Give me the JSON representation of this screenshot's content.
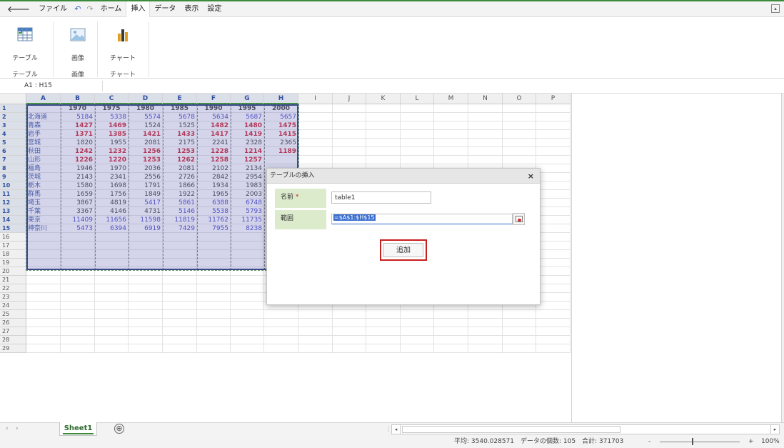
{
  "menu": {
    "file": "ファイル",
    "tabs": [
      "ホーム",
      "挿入",
      "データ",
      "表示",
      "設定"
    ],
    "active_tab": "挿入"
  },
  "ribbon": {
    "table_label": "テーブル",
    "image_label": "画像",
    "chart_label": "チャート",
    "group_table": "テーブル",
    "group_image": "画像",
    "group_chart": "チャート"
  },
  "namebox": "A1 : H15",
  "columns": [
    "A",
    "B",
    "C",
    "D",
    "E",
    "F",
    "G",
    "H",
    "I",
    "J",
    "K",
    "L",
    "M",
    "N",
    "O",
    "P"
  ],
  "rows": [
    "1",
    "2",
    "3",
    "4",
    "5",
    "6",
    "7",
    "8",
    "9",
    "10",
    "11",
    "12",
    "13",
    "14",
    "15",
    "16",
    "17",
    "18",
    "19",
    "20",
    "21",
    "22",
    "23",
    "24",
    "25",
    "26",
    "27",
    "28",
    "29"
  ],
  "table": {
    "headers": [
      "",
      "1970",
      "1975",
      "1980",
      "1985",
      "1990",
      "1995",
      "2000"
    ],
    "data": [
      [
        "北海道",
        "5184",
        "5338",
        "5574",
        "5678",
        "5634",
        "5687",
        "5657"
      ],
      [
        "青森",
        "1427",
        "1469",
        "1524",
        "1525",
        "1482",
        "1480",
        "1475"
      ],
      [
        "岩手",
        "1371",
        "1385",
        "1421",
        "1433",
        "1417",
        "1419",
        "1415"
      ],
      [
        "宮城",
        "1820",
        "1955",
        "2081",
        "2175",
        "2241",
        "2328",
        "2365"
      ],
      [
        "秋田",
        "1242",
        "1232",
        "1256",
        "1253",
        "1228",
        "1214",
        "1189"
      ],
      [
        "山形",
        "1226",
        "1220",
        "1253",
        "1262",
        "1258",
        "1257",
        ""
      ],
      [
        "福島",
        "1946",
        "1970",
        "2036",
        "2081",
        "2102",
        "2134",
        ""
      ],
      [
        "茨城",
        "2143",
        "2341",
        "2556",
        "2726",
        "2842",
        "2954",
        ""
      ],
      [
        "栃木",
        "1580",
        "1698",
        "1791",
        "1866",
        "1934",
        "1983",
        ""
      ],
      [
        "群馬",
        "1659",
        "1756",
        "1849",
        "1922",
        "1965",
        "2003",
        ""
      ],
      [
        "埼玉",
        "3867",
        "4819",
        "5417",
        "5861",
        "6388",
        "6748",
        ""
      ],
      [
        "千葉",
        "3367",
        "4146",
        "4731",
        "5146",
        "5538",
        "5793",
        ""
      ],
      [
        "東京",
        "11409",
        "11656",
        "11598",
        "11819",
        "11762",
        "11735",
        ""
      ],
      [
        "神奈川",
        "5473",
        "6394",
        "6919",
        "7429",
        "7955",
        "8238",
        ""
      ]
    ],
    "cell_colors": [
      [
        "#4040cc",
        "#4040cc",
        "#4040cc",
        "#4040cc",
        "#4040cc",
        "#4040cc",
        "#4040cc"
      ],
      [
        "#cc1a2a",
        "#cc1a2a",
        "#333333",
        "#333333",
        "#cc1a2a",
        "#cc1a2a",
        "#cc1a2a"
      ],
      [
        "#cc1a2a",
        "#cc1a2a",
        "#cc1a2a",
        "#cc1a2a",
        "#cc1a2a",
        "#cc1a2a",
        "#cc1a2a"
      ],
      [
        "#333333",
        "#333333",
        "#333333",
        "#333333",
        "#333333",
        "#333333",
        "#333333"
      ],
      [
        "#cc1a2a",
        "#cc1a2a",
        "#cc1a2a",
        "#cc1a2a",
        "#cc1a2a",
        "#cc1a2a",
        "#cc1a2a"
      ],
      [
        "#cc1a2a",
        "#cc1a2a",
        "#cc1a2a",
        "#cc1a2a",
        "#cc1a2a",
        "#cc1a2a",
        "#333333"
      ],
      [
        "#333333",
        "#333333",
        "#333333",
        "#333333",
        "#333333",
        "#333333",
        "#333333"
      ],
      [
        "#333333",
        "#333333",
        "#333333",
        "#333333",
        "#333333",
        "#333333",
        "#333333"
      ],
      [
        "#333333",
        "#333333",
        "#333333",
        "#333333",
        "#333333",
        "#333333",
        "#333333"
      ],
      [
        "#333333",
        "#333333",
        "#333333",
        "#333333",
        "#333333",
        "#333333",
        "#333333"
      ],
      [
        "#333333",
        "#333333",
        "#4040cc",
        "#4040cc",
        "#4040cc",
        "#4040cc",
        "#333333"
      ],
      [
        "#333333",
        "#333333",
        "#333333",
        "#4040cc",
        "#4040cc",
        "#4040cc",
        "#333333"
      ],
      [
        "#4040cc",
        "#4040cc",
        "#4040cc",
        "#4040cc",
        "#4040cc",
        "#4040cc",
        "#333333"
      ],
      [
        "#4040cc",
        "#4040cc",
        "#4040cc",
        "#4040cc",
        "#4040cc",
        "#4040cc",
        "#333333"
      ]
    ],
    "bold_colors": [
      "#cc1a2a"
    ]
  },
  "dialog": {
    "title": "テーブルの挿入",
    "close": "×",
    "name_label": "名前",
    "required_mark": "*",
    "name_value": "table1",
    "range_label": "範囲",
    "range_value": "=$A$1:$H$15",
    "add_button": "追加"
  },
  "sheets": {
    "active": "Sheet1",
    "add": "⊕"
  },
  "status": {
    "text": "平均: 3540.028571　データの個数: 105　合計: 371703",
    "zoom_minus": "-",
    "zoom_plus": "+",
    "zoom": "100%",
    "zoom_fraction": 0.4
  },
  "colors": {
    "accent_green": "#3c8a3c",
    "selection": "#3a4a8a",
    "add_button_border": "#c81e1e",
    "label_bg": "#dcebcc"
  }
}
